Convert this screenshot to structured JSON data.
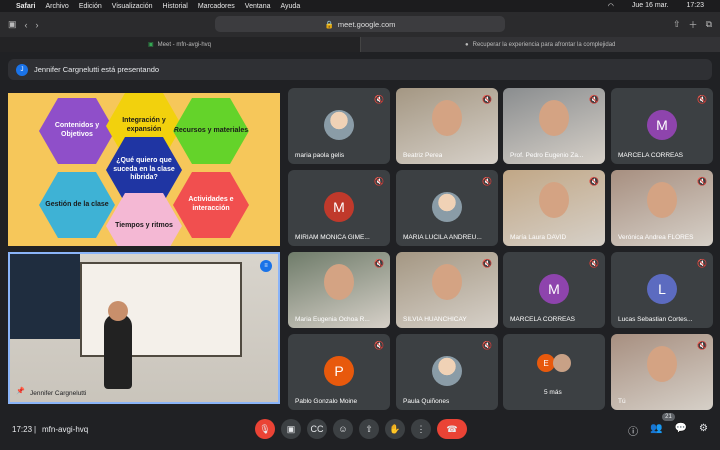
{
  "menubar": {
    "app": "Safari",
    "items": [
      "Archivo",
      "Edición",
      "Visualización",
      "Historial",
      "Marcadores",
      "Ventana",
      "Ayuda"
    ],
    "clock": "Jue 16 mar.",
    "time": "17:23"
  },
  "browser": {
    "url": "meet.google.com",
    "tab1": "Meet - mfn-avgi-hvq",
    "tab2": "Recuperar la experiencia para afrontar la complejidad"
  },
  "presenting": {
    "initial": "J",
    "text": "Jennifer Cargnelutti está presentando"
  },
  "slide": {
    "hexes": [
      "Contenidos y Objetivos",
      "Integración y expansión",
      "Recursos y materiales",
      "¿Qué quiero que suceda en la clase híbrida?",
      "Gestión de la clase",
      "Actividades e interacción",
      "Tiempos y ritmos"
    ]
  },
  "presenter": {
    "name": "Jennifer Cargnelutti"
  },
  "participants": [
    {
      "name": "maria paola gelis",
      "type": "photo"
    },
    {
      "name": "Beatriz Perea",
      "type": "video"
    },
    {
      "name": "Prof. Pedro Eugenio Za...",
      "type": "video"
    },
    {
      "name": "MARCELA CORREAS",
      "type": "avatar",
      "initial": "M",
      "color": "#8e44ad"
    },
    {
      "name": "MIRIAM MONICA GIME...",
      "type": "avatar",
      "initial": "M",
      "color": "#c0392b"
    },
    {
      "name": "MARIA LUCILA ANDREU...",
      "type": "photo"
    },
    {
      "name": "María Laura DAVID",
      "type": "video"
    },
    {
      "name": "Verónica Andrea FLORES",
      "type": "video"
    },
    {
      "name": "Maria Eugenia Ochoa R...",
      "type": "video"
    },
    {
      "name": "SILVIA HUANCHICAY",
      "type": "video"
    },
    {
      "name": "MARCELA CORREAS",
      "type": "avatar",
      "initial": "M",
      "color": "#8e44ad"
    },
    {
      "name": "Lucas Sebastian Cortes...",
      "type": "avatar",
      "initial": "L",
      "color": "#5c6bc0"
    },
    {
      "name": "Pablo Gonzalo Moine",
      "type": "avatar",
      "initial": "P",
      "color": "#e8590c"
    },
    {
      "name": "Paula Quiñones",
      "type": "photo"
    },
    {
      "name": "5 más",
      "type": "more",
      "initial": "E"
    },
    {
      "name": "Tú",
      "type": "video"
    }
  ],
  "bottom": {
    "time": "17:23",
    "meeting": "mfn-avgi-hvq",
    "people_count": "21"
  }
}
